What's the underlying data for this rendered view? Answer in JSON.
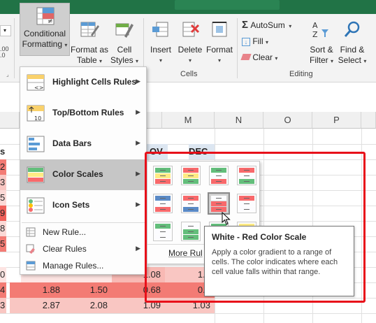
{
  "ribbon": {
    "conditional_formatting": {
      "line1": "Conditional",
      "line2": "Formatting"
    },
    "format_as_table": {
      "line1": "Format as",
      "line2": "Table"
    },
    "cell_styles": {
      "line1": "Cell",
      "line2": "Styles"
    },
    "insert": "Insert",
    "delete": "Delete",
    "format": "Format",
    "cells_group": "Cells",
    "autosum": "AutoSum",
    "fill": "Fill",
    "clear": "Clear",
    "sort_filter": {
      "line1": "Sort &",
      "line2": "Filter"
    },
    "find_select": {
      "line1": "Find &",
      "line2": "Select"
    },
    "editing_group": "Editing",
    "number_fragment": ".00\n.0"
  },
  "menu": {
    "items": [
      {
        "label": "Highlight Cells Rules",
        "icon": "highlight-cells-icon"
      },
      {
        "label": "Top/Bottom Rules",
        "icon": "top-bottom-icon"
      },
      {
        "label": "Data Bars",
        "icon": "data-bars-icon"
      },
      {
        "label": "Color Scales",
        "icon": "color-scales-icon"
      },
      {
        "label": "Icon Sets",
        "icon": "icon-sets-icon"
      }
    ],
    "small_items": [
      {
        "label": "New Rule..."
      },
      {
        "label": "Clear Rules"
      },
      {
        "label": "Manage Rules..."
      }
    ]
  },
  "submenu": {
    "more_rules": "More Rul",
    "tooltip_title": "White - Red Color Scale",
    "tooltip_body": "Apply a color gradient to a range of cells. The color indicates where each cell value falls within that range."
  },
  "grid": {
    "columns": [
      "M",
      "N",
      "O",
      "P"
    ],
    "header_row": {
      "s": "s",
      "nov": "OV",
      "dec": "DEC"
    },
    "row_fragments": [
      "2",
      "3",
      "5",
      "9",
      "8",
      "5",
      "0",
      "4",
      "3"
    ],
    "bottom_rows": [
      {
        "c1": "",
        "c2": "",
        "c3": "",
        "c4": "1.08",
        "c5": "1.8"
      },
      {
        "c1": "1.88",
        "c2": "1.50",
        "c3": "",
        "c4": "0.68",
        "c5": "0.6"
      },
      {
        "c1": "2.87",
        "c2": "2.08",
        "c3": "",
        "c4": "1.09",
        "c5": "1.03"
      }
    ]
  },
  "colors": {
    "excel_green": "#217346",
    "highlight_red": "#e8101a",
    "heat_red": "#f37b74",
    "heat_pink": "#f9c6c2"
  }
}
